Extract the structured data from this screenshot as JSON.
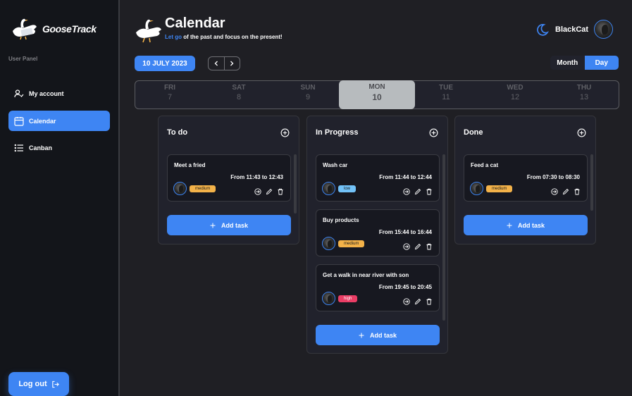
{
  "app": {
    "logo_text": "GooseTrack",
    "user_panel_label": "User Panel",
    "nav": [
      {
        "label": "My account",
        "icon": "user-check-icon"
      },
      {
        "label": "Calendar",
        "icon": "calendar-icon",
        "active": true
      },
      {
        "label": "Canban",
        "icon": "list-icon"
      }
    ],
    "logout_label": "Log out"
  },
  "header": {
    "title": "Calendar",
    "subtitle_highlight": "Let go",
    "subtitle_rest": " of the past and focus on the present!",
    "username": "BlackCat"
  },
  "toolbar": {
    "date_label": "10 JULY 2023",
    "view_month": "Month",
    "view_day": "Day",
    "active_view": "Day"
  },
  "week": [
    {
      "name": "FRI",
      "date": "7"
    },
    {
      "name": "SAT",
      "date": "8"
    },
    {
      "name": "SUN",
      "date": "9"
    },
    {
      "name": "MON",
      "date": "10",
      "selected": true
    },
    {
      "name": "TUE",
      "date": "11"
    },
    {
      "name": "WED",
      "date": "12"
    },
    {
      "name": "THU",
      "date": "13"
    }
  ],
  "columns": [
    {
      "title": "To do",
      "add_label": "Add task",
      "tasks": [
        {
          "title": "Meet a fried",
          "time": "From 11:43 to 12:43",
          "priority": "medium"
        }
      ]
    },
    {
      "title": "In Progress",
      "add_label": "Add task",
      "tasks": [
        {
          "title": "Wash car",
          "time": "From 11:44 to 12:44",
          "priority": "low"
        },
        {
          "title": "Buy products",
          "time": "From 15:44 to 16:44",
          "priority": "medium"
        },
        {
          "title": "Get a walk in near river with son",
          "time": "From 19:45 to 20:45",
          "priority": "high"
        }
      ]
    },
    {
      "title": "Done",
      "add_label": "Add task",
      "tasks": [
        {
          "title": "Feed a cat",
          "time": "From 07:30 to 08:30",
          "priority": "medium"
        }
      ]
    }
  ],
  "colors": {
    "accent": "#3e85f3",
    "sidebar_bg": "#13151a",
    "main_bg": "#1f1f24",
    "panel_bg": "#21222c",
    "priority_medium": "#f3b249",
    "priority_low": "#72c2f8",
    "priority_high": "#ea3d65"
  }
}
